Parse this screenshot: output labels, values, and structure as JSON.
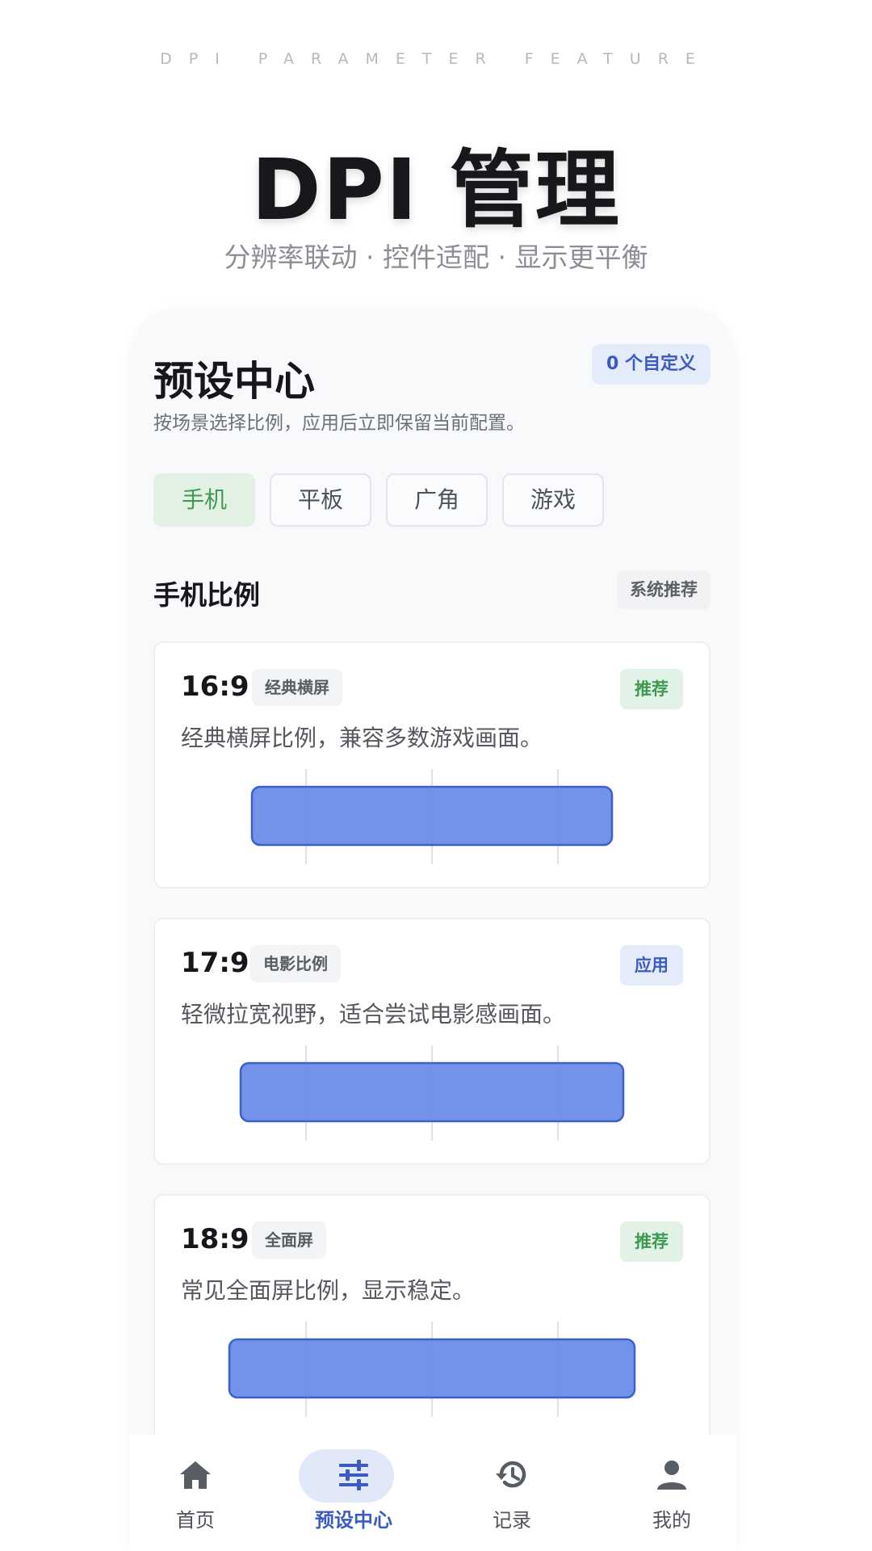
{
  "header": {
    "eyebrow": "DPI PARAMETER FEATURE",
    "title": "DPI 管理",
    "subtitle": "分辨率联动 · 控件适配 · 显示更平衡"
  },
  "panel": {
    "title": "预设中心",
    "custom_badge": "0 个自定义",
    "description": "按场景选择比例，应用后立即保留当前配置。",
    "chips": [
      {
        "label": "手机",
        "active": true
      },
      {
        "label": "平板",
        "active": false
      },
      {
        "label": "广角",
        "active": false
      },
      {
        "label": "游戏",
        "active": false
      }
    ],
    "section_title": "手机比例",
    "section_tag": "系统推荐",
    "cards": [
      {
        "ratio": "16:9",
        "tag": "经典横屏",
        "status": "推荐",
        "status_type": "recommend",
        "desc": "经典横屏比例，兼容多数游戏画面。",
        "aspect_w": 16
      },
      {
        "ratio": "17:9",
        "tag": "电影比例",
        "status": "应用",
        "status_type": "apply",
        "desc": "轻微拉宽视野，适合尝试电影感画面。",
        "aspect_w": 17
      },
      {
        "ratio": "18:9",
        "tag": "全面屏",
        "status": "推荐",
        "status_type": "recommend",
        "desc": "常见全面屏比例，显示稳定。",
        "aspect_w": 18
      }
    ]
  },
  "nav": {
    "items": [
      {
        "label": "首页",
        "icon": "home-icon",
        "active": false
      },
      {
        "label": "预设中心",
        "icon": "sliders-icon",
        "active": true
      },
      {
        "label": "记录",
        "icon": "history-icon",
        "active": false
      },
      {
        "label": "我的",
        "icon": "user-icon",
        "active": false
      }
    ]
  },
  "colors": {
    "accent": "#3b5bc2",
    "preview_fill": "#6a8de8",
    "preview_stroke": "#3d5fd0",
    "recommend": "#3c9a50"
  }
}
